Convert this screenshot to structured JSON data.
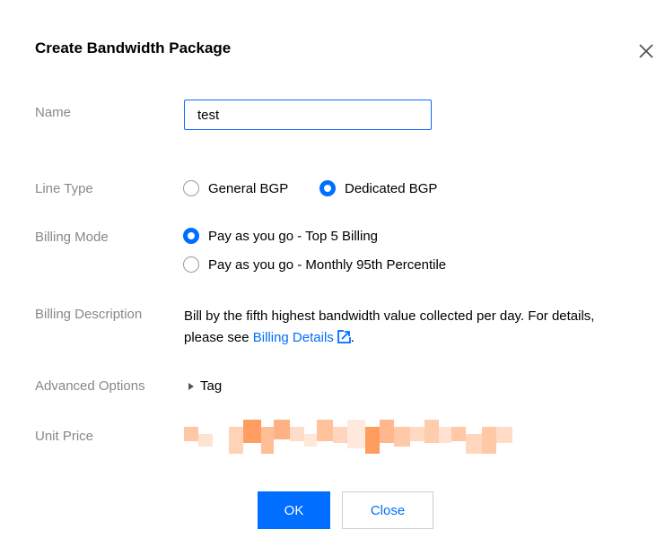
{
  "dialog": {
    "title": "Create Bandwidth Package",
    "close_icon": "close-icon"
  },
  "form": {
    "name": {
      "label": "Name",
      "value": "test"
    },
    "line_type": {
      "label": "Line Type",
      "options": [
        {
          "label": "General BGP",
          "selected": false
        },
        {
          "label": "Dedicated BGP",
          "selected": true
        }
      ]
    },
    "billing_mode": {
      "label": "Billing Mode",
      "options": [
        {
          "label": "Pay as you go - Top 5 Billing",
          "selected": true
        },
        {
          "label": "Pay as you go - Monthly 95th Percentile",
          "selected": false
        }
      ]
    },
    "billing_description": {
      "label": "Billing Description",
      "text": "Bill by the fifth highest bandwidth value collected per day. For details, please see",
      "link": "Billing Details",
      "suffix": "."
    },
    "advanced_options": {
      "label": "Advanced Options",
      "toggle": "Tag"
    },
    "unit_price": {
      "label": "Unit Price"
    }
  },
  "footer": {
    "ok_label": "OK",
    "close_label": "Close"
  },
  "colors": {
    "accent": "#006eff",
    "label": "#888888",
    "price_blur": "#ff9a5c"
  }
}
